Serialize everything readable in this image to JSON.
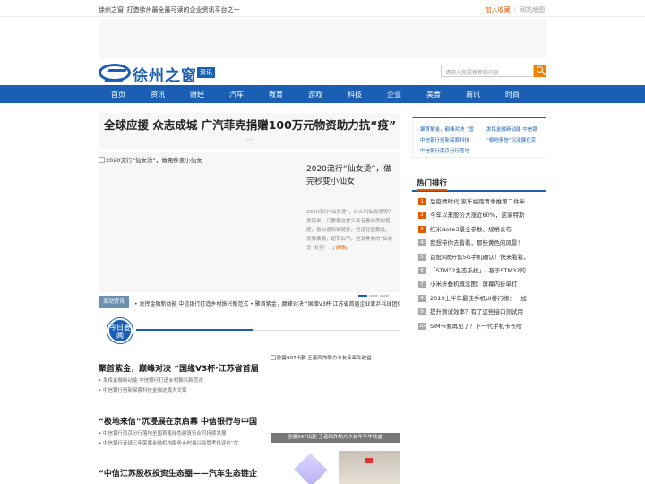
{
  "topbar": {
    "slogan": "徐州之窗_打造徐州最全最可读的企业资讯平台之一",
    "favorite": "加入收藏",
    "sitemap": "网站地图"
  },
  "logo": {
    "name": "徐州之窗",
    "tag": "资讯"
  },
  "search": {
    "placeholder": "请输入您要搜索的内容",
    "icon": "search-icon"
  },
  "nav": [
    "首页",
    "资讯",
    "财经",
    "汽车",
    "教育",
    "游戏",
    "科技",
    "企业",
    "美食",
    "商讯",
    "时尚"
  ],
  "headline": {
    "title": "全球应援 众志成城 广汽菲克捐赠100万元物资助力抗“疫”",
    "more": "…"
  },
  "slider": {
    "image_caption": "2020流行“仙女烫”，做完秒变小仙女",
    "title": "2020流行“仙女烫”，做完秒变小仙女",
    "desc": "2020流行“仙女烫”，什么叫仙女烫呢？很简单，只要像这样头发有着自然的弧度，看似很简单随意，但是轻盈飘逸，优雅慵懒，超带仙气，这就美美的“仙女烫”发型！...",
    "more": "[详情]"
  },
  "ticker": {
    "label": "滚动资讯",
    "text": "• 发挥金融新动能 中信银行打造乡村振兴新范式  • 聚首紫金，巅峰对决 “国缘V3杯·江苏省首届企业家乒乓球团体赛”圆满收官  • 发挥金融新动能 中信银行打"
  },
  "today": {
    "label": "今日要闻"
  },
  "news": [
    {
      "title": "聚首紫金，巅峰对决 “国缘V3杯·江苏省首届",
      "subs": [
        "发挥金融新动能 中信银行打造乡村振兴新范式",
        "中信银行创新探索科技金融这篇大文章"
      ]
    },
    {
      "title": "“极地来信”沉浸展在京启幕 中信银行与中国",
      "subs": [
        "中信银行南京分行落地全国首笔绿色建筑行业可持续发展",
        "中信银行连续三年荣膺金融机构服务乡村振兴监管考核评价“优"
      ]
    },
    {
      "title": "“中信江苏股权投资生态圈——汽车生态链企",
      "subs": []
    }
  ],
  "sidepic": {
    "caption": "欧曼997出勤 王者四炸助力卡友年年牛收益",
    "bar": "欧曼997出勤 王者四炸助力卡友年年牛收益"
  },
  "right_links": [
    "聚首紫金，巅峰对决 “国",
    "发挥金融新动能 中信银",
    "中信银行创新探索科技",
    "“极地来信”沉浸展在京",
    "中信银行南京分行落地"
  ],
  "hot": {
    "title": "热门排行",
    "items": [
      "后疫情时代 家乐福踏青季推第二件半",
      "今年以来股价大涨近60%，这家特斯",
      "红米Note3最全参数、规格公布",
      "我想带你去看看，那些黄色的风景！",
      "首批8款开售5G手机确认！快来看看，",
      "「STM32生态系统」- 基于STM32的",
      "小米折叠机概念图：屏幕内折单打",
      "2019上半年最佳手机UI排行榜：一加",
      "提升测试效率？有了这些接口测试用",
      "SIM卡要再见了？下一代手机卡长啥"
    ]
  },
  "colors": {
    "brand": "#1a5fb4",
    "accent": "#e05a00"
  }
}
